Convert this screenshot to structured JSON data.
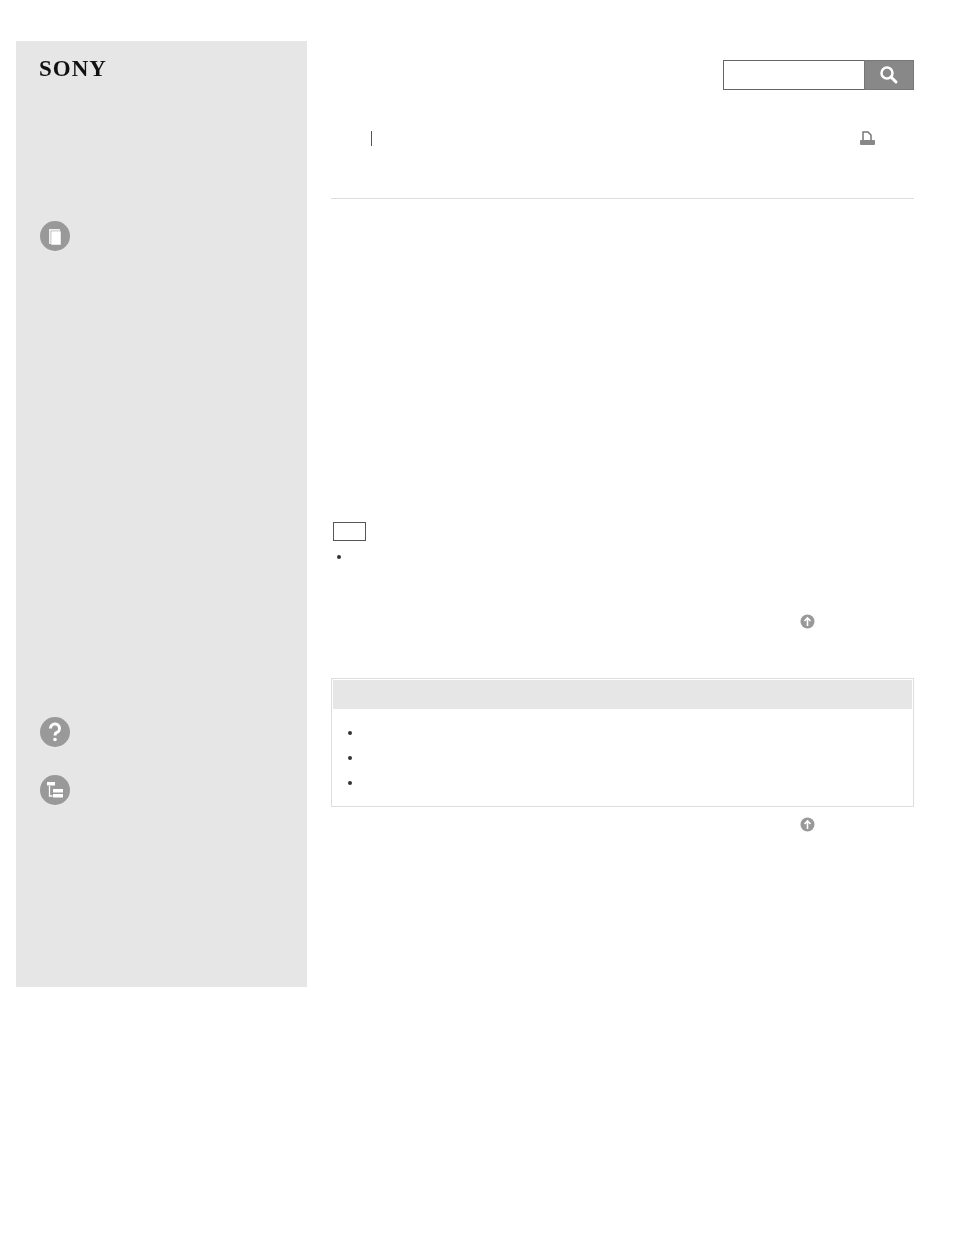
{
  "logo": "SONY",
  "note_list": [
    {
      "kind": "bullet"
    }
  ],
  "related_list": [
    {
      "kind": "bullet"
    },
    {
      "kind": "bullet"
    },
    {
      "kind": "bullet"
    }
  ]
}
